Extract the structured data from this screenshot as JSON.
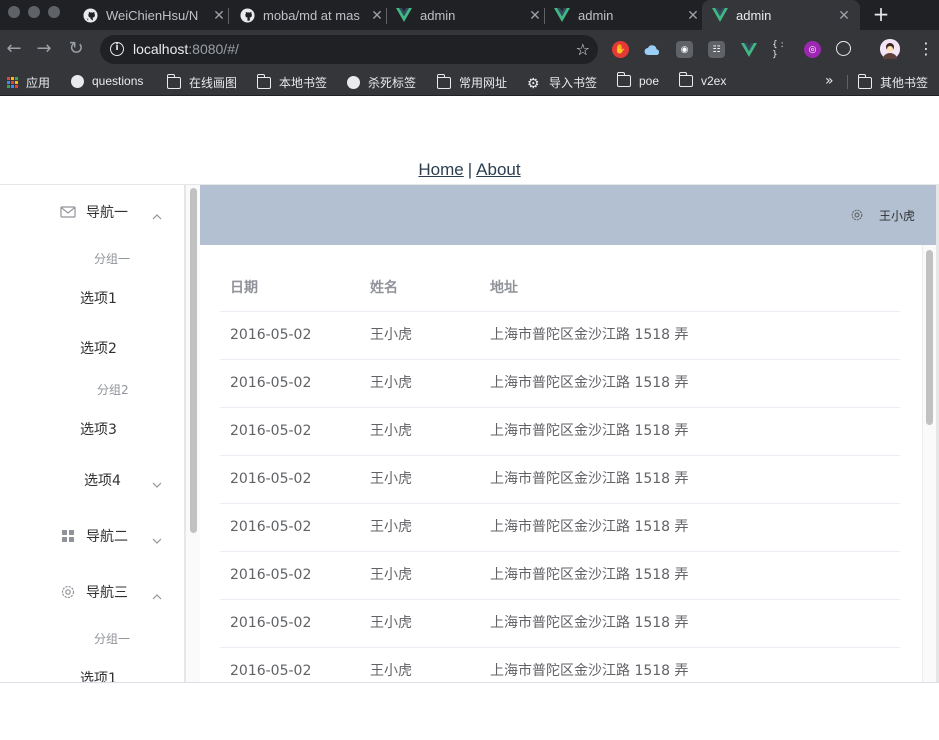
{
  "browser": {
    "tabs": [
      {
        "title": "WeiChienHsu/N",
        "icon": "github-icon"
      },
      {
        "title": "moba/md at mas",
        "icon": "github-icon"
      },
      {
        "title": "admin",
        "icon": "vue-icon"
      },
      {
        "title": "admin",
        "icon": "vue-icon"
      },
      {
        "title": "admin",
        "icon": "vue-icon",
        "active": true
      }
    ],
    "url_host": "localhost",
    "url_rest": ":8080/#/",
    "bookmarks": [
      {
        "label": "应用",
        "icon": "apps-grid-icon"
      },
      {
        "label": "questions",
        "icon": "globe-icon"
      },
      {
        "label": "在线画图",
        "icon": "folder-icon"
      },
      {
        "label": "本地书签",
        "icon": "folder-icon"
      },
      {
        "label": "杀死标签",
        "icon": "globe-icon"
      },
      {
        "label": "常用网址",
        "icon": "folder-icon"
      },
      {
        "label": "导入书签",
        "icon": "gear-icon"
      },
      {
        "label": "poe",
        "icon": "folder-icon"
      },
      {
        "label": "v2ex",
        "icon": "folder-icon"
      }
    ],
    "other_bookmarks": "其他书签",
    "more": "»",
    "close_glyph": "✕",
    "newtab_glyph": "+"
  },
  "topnav": {
    "home": "Home",
    "separator": "|",
    "about": "About"
  },
  "sidebar": {
    "nav1": {
      "label": "导航一",
      "icon": "message-icon"
    },
    "group1": "分组一",
    "option1": "选项1",
    "option2": "选项2",
    "group2": "分组2",
    "option3": "选项3",
    "option4": "选项4",
    "nav2": {
      "label": "导航二",
      "icon": "menu-grid-icon"
    },
    "nav3": {
      "label": "导航三",
      "icon": "setting-icon"
    },
    "nav3_group1": "分组一",
    "nav3_option1": "选项1"
  },
  "header": {
    "user": "王小虎",
    "icon": "setting-icon"
  },
  "table": {
    "columns": [
      "日期",
      "姓名",
      "地址"
    ],
    "rows": [
      [
        "2016-05-02",
        "王小虎",
        "上海市普陀区金沙江路 1518 弄"
      ],
      [
        "2016-05-02",
        "王小虎",
        "上海市普陀区金沙江路 1518 弄"
      ],
      [
        "2016-05-02",
        "王小虎",
        "上海市普陀区金沙江路 1518 弄"
      ],
      [
        "2016-05-02",
        "王小虎",
        "上海市普陀区金沙江路 1518 弄"
      ],
      [
        "2016-05-02",
        "王小虎",
        "上海市普陀区金沙江路 1518 弄"
      ],
      [
        "2016-05-02",
        "王小虎",
        "上海市普陀区金沙江路 1518 弄"
      ],
      [
        "2016-05-02",
        "王小虎",
        "上海市普陀区金沙江路 1518 弄"
      ],
      [
        "2016-05-02",
        "王小虎",
        "上海市普陀区金沙江路 1518 弄"
      ]
    ]
  },
  "colors": {
    "header_bg": "#b3c0d1",
    "chrome_dark": "#202124",
    "chrome_bar": "#35363a",
    "vue_green": "#41b883"
  }
}
